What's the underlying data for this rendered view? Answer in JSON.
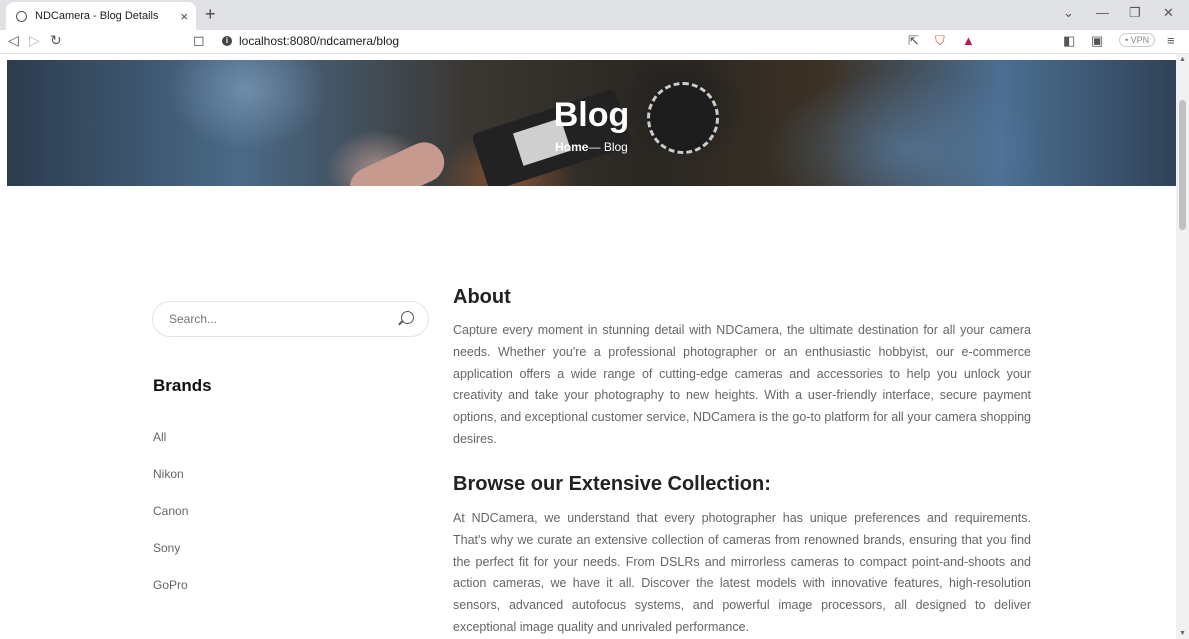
{
  "browser": {
    "tab_title": "NDCamera - Blog Details",
    "tab_close": "×",
    "new_tab": "+",
    "url": "localhost:8080/ndcamera/blog",
    "vpn_label": "• VPN"
  },
  "hero": {
    "title": "Blog",
    "breadcrumb_home": "Home",
    "breadcrumb_sep": "—",
    "breadcrumb_current": "Blog"
  },
  "sidebar": {
    "search_placeholder": "Search...",
    "brands_heading": "Brands",
    "brands": [
      "All",
      "Nikon",
      "Canon",
      "Sony",
      "GoPro"
    ]
  },
  "content": {
    "about_heading": "About",
    "about_text": "Capture every moment in stunning detail with NDCamera, the ultimate destination for all your camera needs. Whether you're a professional photographer or an enthusiastic hobbyist, our e-commerce application offers a wide range of cutting-edge cameras and accessories to help you unlock your creativity and take your photography to new heights. With a user-friendly interface, secure payment options, and exceptional customer service, NDCamera is the go-to platform for all your camera shopping desires.",
    "collection_heading": "Browse our Extensive Collection:",
    "collection_text": "At NDCamera, we understand that every photographer has unique preferences and requirements. That's why we curate an extensive collection of cameras from renowned brands, ensuring that you find the perfect fit for your needs. From DSLRs and mirrorless cameras to compact point-and-shoots and action cameras, we have it all. Discover the latest models with innovative features, high-resolution sensors, advanced autofocus systems, and powerful image processors, all designed to deliver exceptional image quality and unrivaled performance."
  }
}
